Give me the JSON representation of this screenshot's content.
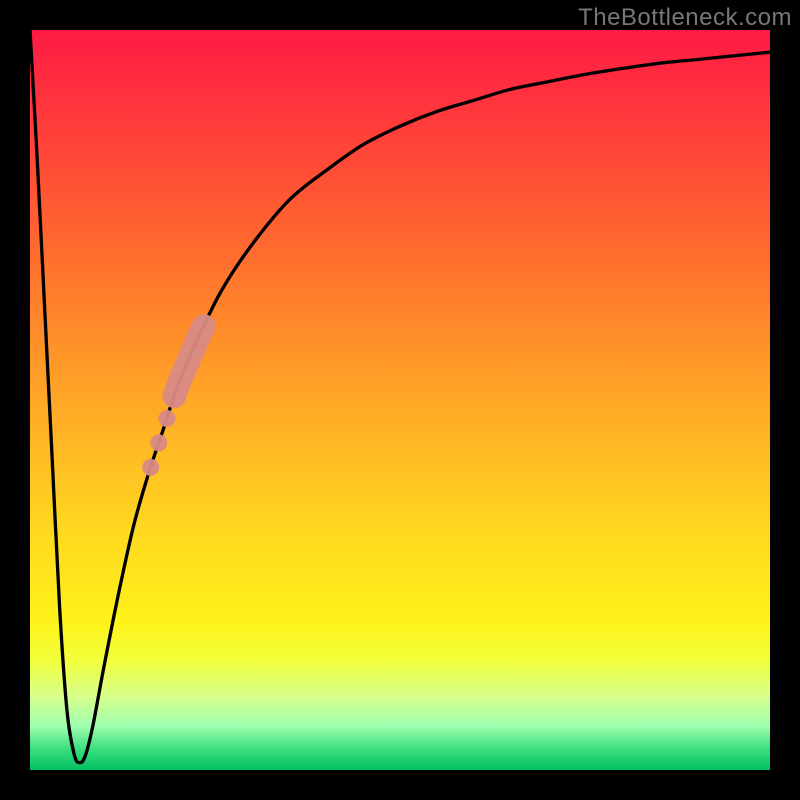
{
  "watermark": "TheBottleneck.com",
  "colors": {
    "frame": "#000000",
    "curve": "#000000",
    "marker": "#d98a85",
    "gradient_top": "#ff1a44",
    "gradient_bottom": "#00c060"
  },
  "chart_data": {
    "type": "line",
    "title": "",
    "xlabel": "",
    "ylabel": "",
    "xlim": [
      0,
      100
    ],
    "ylim": [
      0,
      100
    ],
    "grid": false,
    "legend": false,
    "series": [
      {
        "name": "bottleneck-curve",
        "x": [
          0,
          1,
          2,
          3,
          4,
          5,
          6,
          6.8,
          7.5,
          8.5,
          10,
          12,
          14,
          16,
          18,
          20,
          23,
          26,
          30,
          35,
          40,
          45,
          50,
          55,
          60,
          65,
          70,
          75,
          80,
          85,
          90,
          95,
          100
        ],
        "values": [
          100,
          82,
          62,
          42,
          22,
          8,
          2,
          1,
          2,
          6,
          14,
          24,
          33,
          40,
          46,
          52,
          59,
          65,
          71,
          77,
          81,
          84.5,
          87,
          89,
          90.5,
          92,
          93,
          94,
          94.8,
          95.5,
          96,
          96.5,
          97
        ]
      }
    ],
    "markers": [
      {
        "name": "highlight-segment-top",
        "x_start": 19.5,
        "x_end": 23.5,
        "radius": 1.6
      },
      {
        "name": "highlight-dot-1",
        "x": 18.5,
        "radius": 1.15
      },
      {
        "name": "highlight-dot-2",
        "x": 17.4,
        "radius": 1.15
      },
      {
        "name": "highlight-dot-3",
        "x": 16.3,
        "radius": 1.15
      }
    ],
    "annotations": []
  }
}
